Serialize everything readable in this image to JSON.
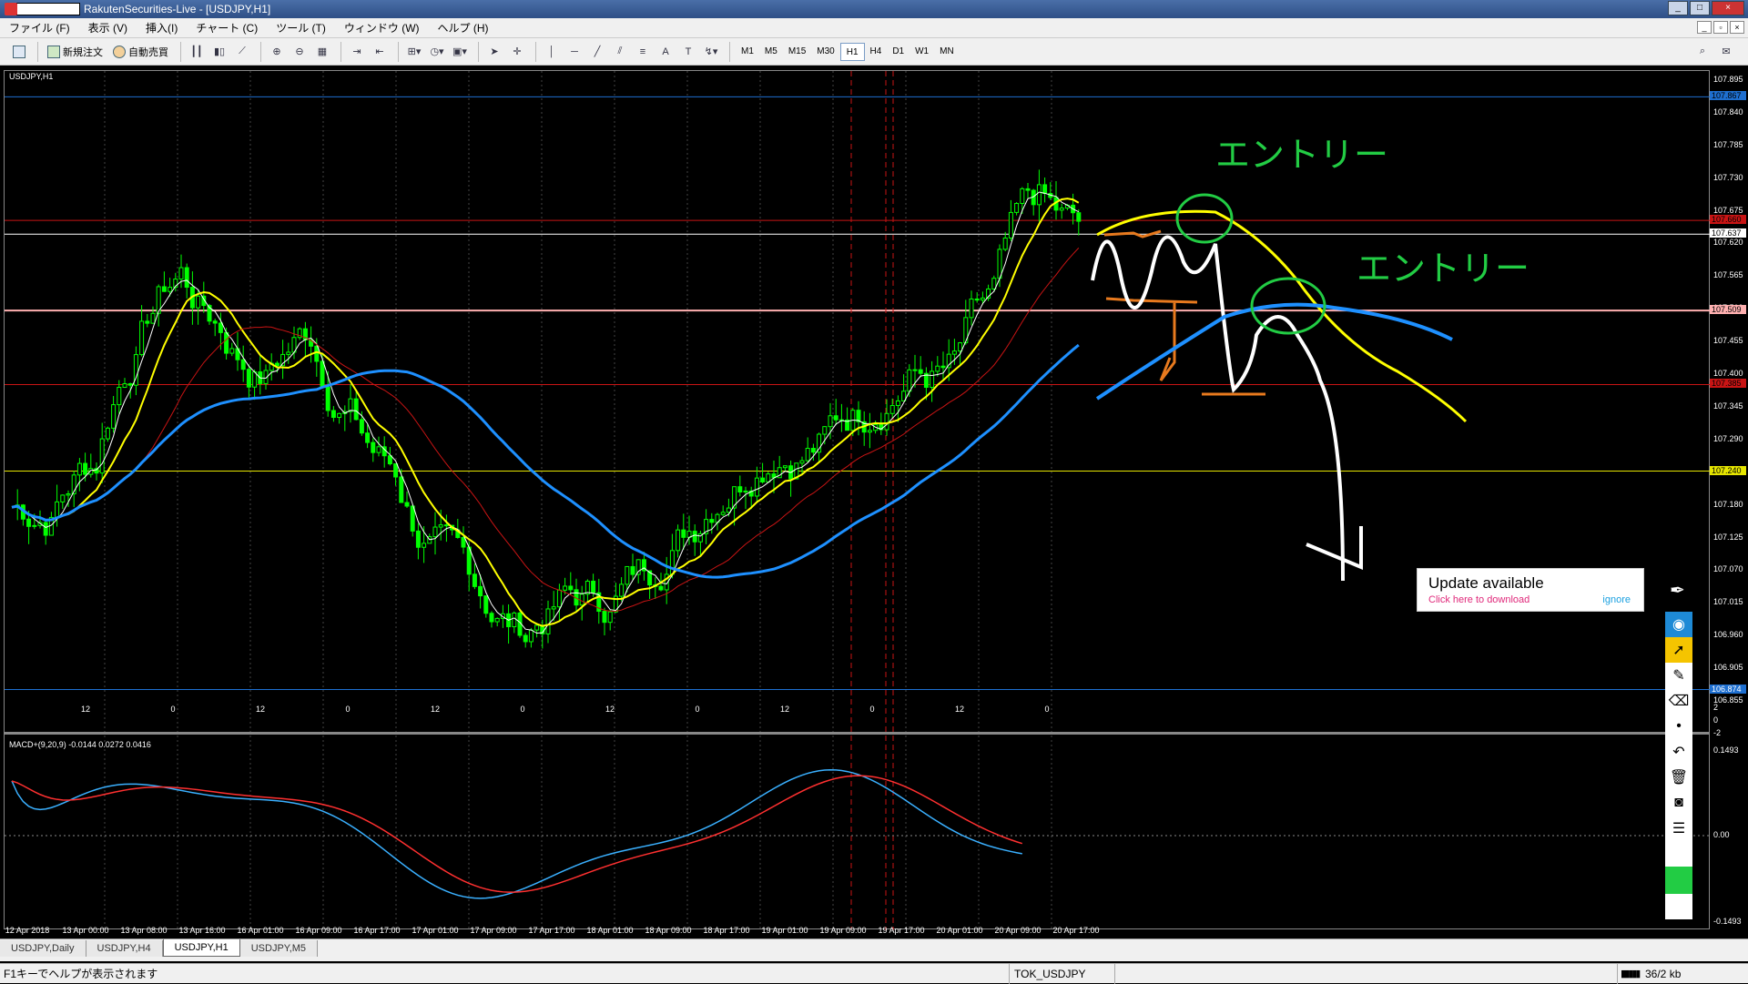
{
  "window": {
    "title": "RakutenSecurities-Live - [USDJPY,H1]",
    "buttons": [
      "_",
      "□",
      "×"
    ]
  },
  "menu": [
    "ファイル (F)",
    "表示 (V)",
    "挿入(I)",
    "チャート (C)",
    "ツール (T)",
    "ウィンドウ (W)",
    "ヘルプ (H)"
  ],
  "toolbar": {
    "new_order": "新規注文",
    "auto_trade": "自動売買",
    "timeframes": [
      "M1",
      "M5",
      "M15",
      "M30",
      "H1",
      "H4",
      "D1",
      "W1",
      "MN"
    ],
    "active_timeframe": "H1"
  },
  "chart": {
    "symbol_label": "USDJPY,H1",
    "macd_label": "MACD+(9,20,9) -0.0144 0.0272 0.0416",
    "price_ticks": [
      "107.895",
      "107.840",
      "107.785",
      "107.730",
      "107.675",
      "107.620",
      "107.565",
      "107.510",
      "107.455",
      "107.400",
      "107.345",
      "107.290",
      "107.235",
      "107.180",
      "107.125",
      "107.070",
      "107.015",
      "106.960",
      "106.905",
      "106.855"
    ],
    "price_badges": [
      {
        "label": "107.867",
        "color": "#1e6fd0",
        "text_color": "#000"
      },
      {
        "label": "107.660",
        "color": "#c81414",
        "text_color": "#000"
      },
      {
        "label": "107.637",
        "color": "#ffffff",
        "text_color": "#000"
      },
      {
        "label": "107.509",
        "color": "#ffb0b0",
        "text_color": "#000"
      },
      {
        "label": "107.385",
        "color": "#c81414",
        "text_color": "#000"
      },
      {
        "label": "107.240",
        "color": "#e6e600",
        "text_color": "#000"
      },
      {
        "label": "106.874",
        "color": "#1e6fd0",
        "text_color": "#fff"
      }
    ],
    "subpane_ticks": [
      "2",
      "0",
      "-2"
    ],
    "macd_ticks": [
      "0.1493",
      "0.00",
      "-0.1493"
    ],
    "hour_ticks": [
      "12",
      "0",
      "12",
      "0",
      "12",
      "0",
      "12",
      "0",
      "12",
      "0",
      "12",
      "0"
    ],
    "date_ticks": [
      "12 Apr 2018",
      "13 Apr 00:00",
      "13 Apr 08:00",
      "13 Apr 16:00",
      "16 Apr 01:00",
      "16 Apr 09:00",
      "16 Apr 17:00",
      "17 Apr 01:00",
      "17 Apr 09:00",
      "17 Apr 17:00",
      "18 Apr 01:00",
      "18 Apr 09:00",
      "18 Apr 17:00",
      "19 Apr 01:00",
      "19 Apr 09:00",
      "19 Apr 17:00",
      "20 Apr 01:00",
      "20 Apr 09:00",
      "20 Apr 17:00"
    ],
    "annotations": [
      "エントリー",
      "エントリー"
    ],
    "colors": {
      "candle": "#00ff00",
      "ma_fast": "#ffffff",
      "ma_yellow": "#ffff00",
      "ma_red": "#c81414",
      "ma_blue": "#1e90ff",
      "macd_main": "#3ab0ff",
      "macd_signal": "#ff3030"
    }
  },
  "tabs": [
    "USDJPY,Daily",
    "USDJPY,H4",
    "USDJPY,H1",
    "USDJPY,M5"
  ],
  "active_tab": "USDJPY,H1",
  "status": {
    "help": "F1キーでヘルプが表示されます",
    "profile": "TOK_USDJPY",
    "traffic": "36/2 kb"
  },
  "popup": {
    "title": "Update available",
    "link": "Click here to download",
    "ignore": "ignore"
  }
}
